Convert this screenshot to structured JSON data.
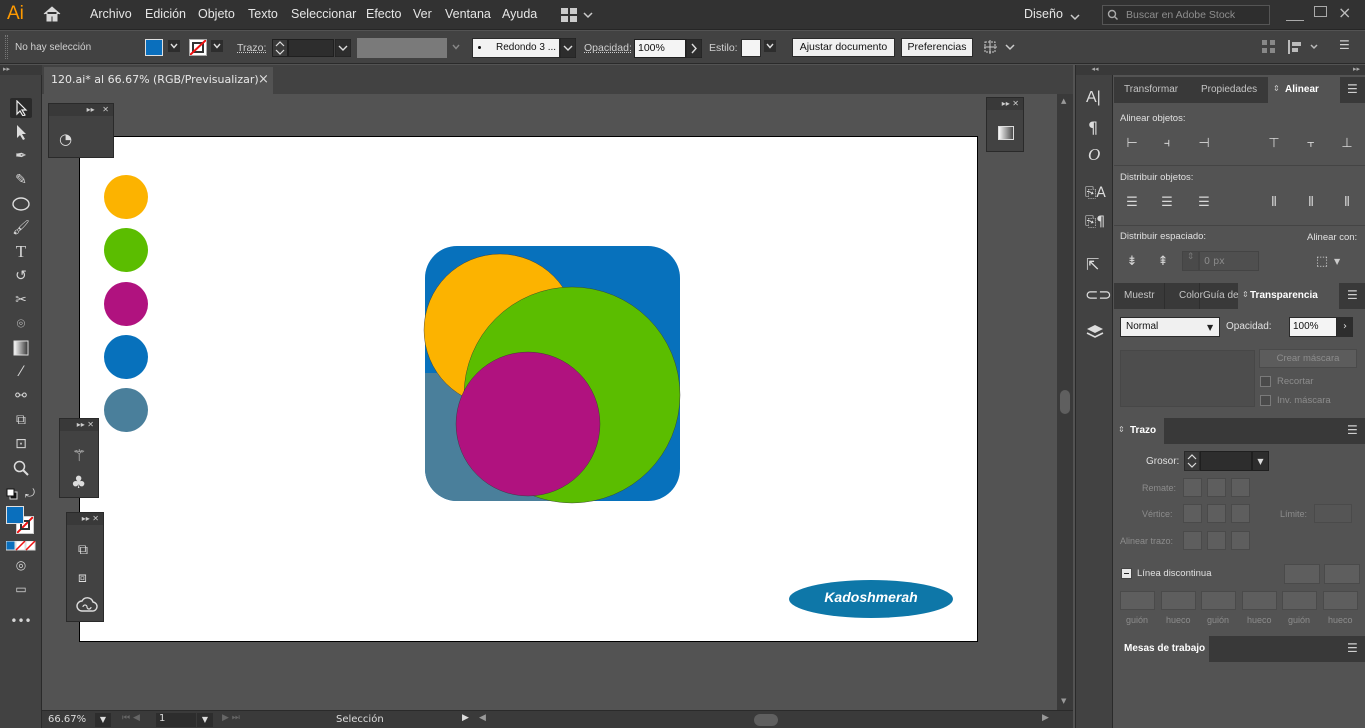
{
  "app": {
    "logo": "Ai",
    "menus": [
      "Archivo",
      "Edición",
      "Objeto",
      "Texto",
      "Seleccionar",
      "Efecto",
      "Ver",
      "Ventana",
      "Ayuda"
    ],
    "workspace": "Diseño",
    "stock_search_placeholder": "Buscar en Adobe Stock"
  },
  "control_bar": {
    "selection_status": "No hay selección",
    "fill_color": "#0a6fbd",
    "stroke_label": "Trazo:",
    "brush_label": "Redondo 3 ...",
    "opacity_label": "Opacidad:",
    "opacity_value": "100%",
    "style_label": "Estilo:",
    "fit_document_button": "Ajustar documento",
    "preferences_button": "Preferencias"
  },
  "document": {
    "tab_title": "120.ai* al 66.67% (RGB/Previsualizar)",
    "close_glyph": "×"
  },
  "artwork": {
    "swatches": [
      "#fcb300",
      "#5bbd00",
      "#b0127f",
      "#0771bc",
      "#4a7f9b"
    ],
    "logo_text": "Kadoshmerah",
    "logo_color": "#0e77a8",
    "shape_colors": {
      "blue": "#0771bc",
      "teal": "#4a7f9b",
      "yellow": "#fcb300",
      "green": "#5bbd00",
      "magenta": "#b0127f"
    }
  },
  "status_bar": {
    "zoom": "66.67%",
    "artboard_number": "1",
    "tool_status": "Selección"
  },
  "panels": {
    "align_tabs": [
      "Transformar",
      "Propiedades",
      "Alinear"
    ],
    "align_objects_label": "Alinear objetos:",
    "distribute_objects_label": "Distribuir objetos:",
    "distribute_spacing_label": "Distribuir espaciado:",
    "align_to_label": "Alinear con:",
    "spacing_value": "0 px",
    "transparency_tabs": [
      "Muestr",
      "Color",
      "Guía de",
      "Transparencia"
    ],
    "blend_mode": "Normal",
    "opacity_label": "Opacidad:",
    "opacity_value": "100%",
    "make_mask_button": "Crear máscara",
    "clip_label": "Recortar",
    "invert_mask_label": "Inv. máscara",
    "stroke_tab": "Trazo",
    "weight_label": "Grosor:",
    "cap_label": "Remate:",
    "corner_label": "Vértice:",
    "limit_label": "Límite:",
    "align_stroke_label": "Alinear trazo:",
    "dashed_line_label": "Línea discontinua",
    "dash_labels": [
      "guión",
      "hueco",
      "guión",
      "hueco",
      "guión",
      "hueco"
    ],
    "artboards_tab": "Mesas de trabajo"
  }
}
